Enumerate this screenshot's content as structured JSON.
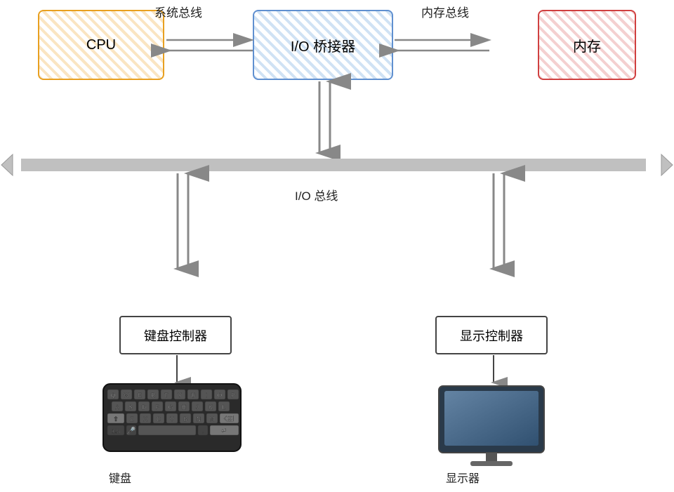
{
  "labels": {
    "cpu": "CPU",
    "io_bridge": "I/O 桥接器",
    "memory": "内存",
    "system_bus": "系统总线",
    "memory_bus": "内存总线",
    "io_bus": "I/O 总线",
    "keyboard_ctrl": "键盘控制器",
    "display_ctrl": "显示控制器",
    "keyboard": "键盘",
    "display": "显示器"
  },
  "colors": {
    "cpu_border": "#e8a020",
    "io_border": "#6090d0",
    "mem_border": "#d04040",
    "arrow_fill": "#bbb",
    "arrow_stroke": "#888",
    "small_arrow": "#555"
  }
}
